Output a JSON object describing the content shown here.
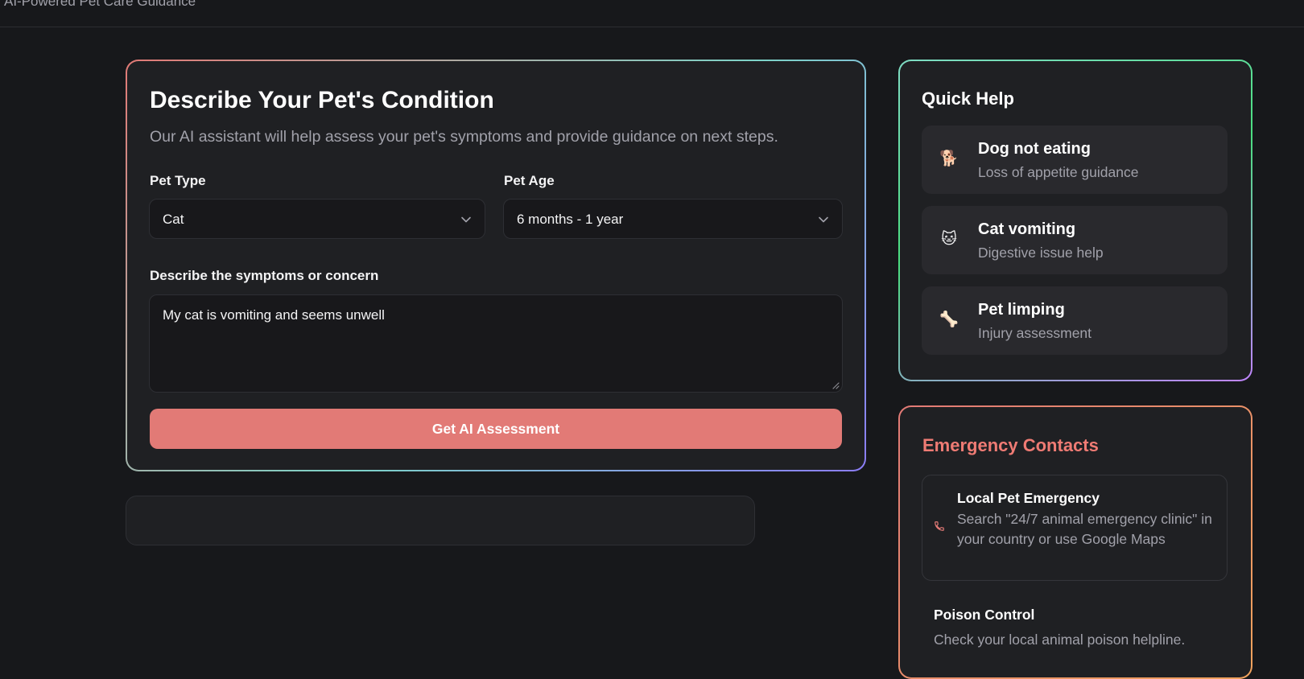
{
  "header": {
    "tagline": "AI-Powered Pet Care Guidance"
  },
  "form": {
    "title": "Describe Your Pet's Condition",
    "subtitle": "Our AI assistant will help assess your pet's symptoms and provide guidance on next steps.",
    "pet_type_label": "Pet Type",
    "pet_type_value": "Cat",
    "pet_age_label": "Pet Age",
    "pet_age_value": "6 months - 1 year",
    "symptoms_label": "Describe the symptoms or concern",
    "symptoms_value": "My cat is vomiting and seems unwell",
    "submit_label": "Get AI Assessment"
  },
  "quick_help": {
    "title": "Quick Help",
    "items": [
      {
        "icon": "dog-emoji-icon",
        "glyph": "🐕",
        "label": "Dog not eating",
        "sub": "Loss of appetite guidance"
      },
      {
        "icon": "cat-emoji-icon",
        "glyph": "🐱",
        "label": "Cat vomiting",
        "sub": "Digestive issue help"
      },
      {
        "icon": "bone-icon",
        "glyph": "🦴",
        "label": "Pet limping",
        "sub": "Injury assessment"
      }
    ]
  },
  "emergency": {
    "title": "Emergency Contacts",
    "contacts": [
      {
        "icon": "phone-icon",
        "label": "Local Pet Emergency",
        "desc": "Search \"24/7 animal emergency clinic\" in your country or use Google Maps"
      },
      {
        "label": "Poison Control",
        "desc": "Check your local animal poison helpline."
      }
    ]
  },
  "colors": {
    "accent": "#e27a76",
    "background": "#17181b",
    "card": "#1f2023",
    "emergency_title": "#ef7b74"
  }
}
